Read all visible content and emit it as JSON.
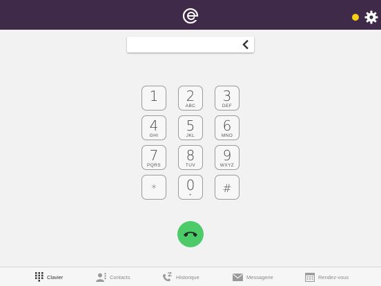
{
  "header": {
    "logo_icon": "e-logo-icon",
    "status_color": "#f7cf14",
    "settings_icon": "gear-icon"
  },
  "dial_input": {
    "value": "",
    "backspace_icon": "chevron-left-icon"
  },
  "keypad": [
    {
      "digit": "1",
      "letters": ""
    },
    {
      "digit": "2",
      "letters": "ABC"
    },
    {
      "digit": "3",
      "letters": "DEF"
    },
    {
      "digit": "4",
      "letters": "GHI"
    },
    {
      "digit": "5",
      "letters": "JKL"
    },
    {
      "digit": "6",
      "letters": "MNO"
    },
    {
      "digit": "7",
      "letters": "PQRS"
    },
    {
      "digit": "8",
      "letters": "TUV"
    },
    {
      "digit": "9",
      "letters": "WXYZ"
    },
    {
      "digit": "*",
      "letters": ""
    },
    {
      "digit": "0",
      "letters": "+"
    },
    {
      "digit": "#",
      "letters": ""
    }
  ],
  "call_button": {
    "icon": "phone-icon",
    "color": "#4ccb68"
  },
  "tabs": [
    {
      "label": "Clavier",
      "icon": "keypad-icon",
      "active": true
    },
    {
      "label": "Contacts",
      "icon": "contacts-icon",
      "active": false
    },
    {
      "label": "Historique",
      "icon": "history-icon",
      "active": false
    },
    {
      "label": "Messagerie",
      "icon": "mail-icon",
      "active": false
    },
    {
      "label": "Rendez-vous",
      "icon": "calendar-icon",
      "active": false
    }
  ]
}
